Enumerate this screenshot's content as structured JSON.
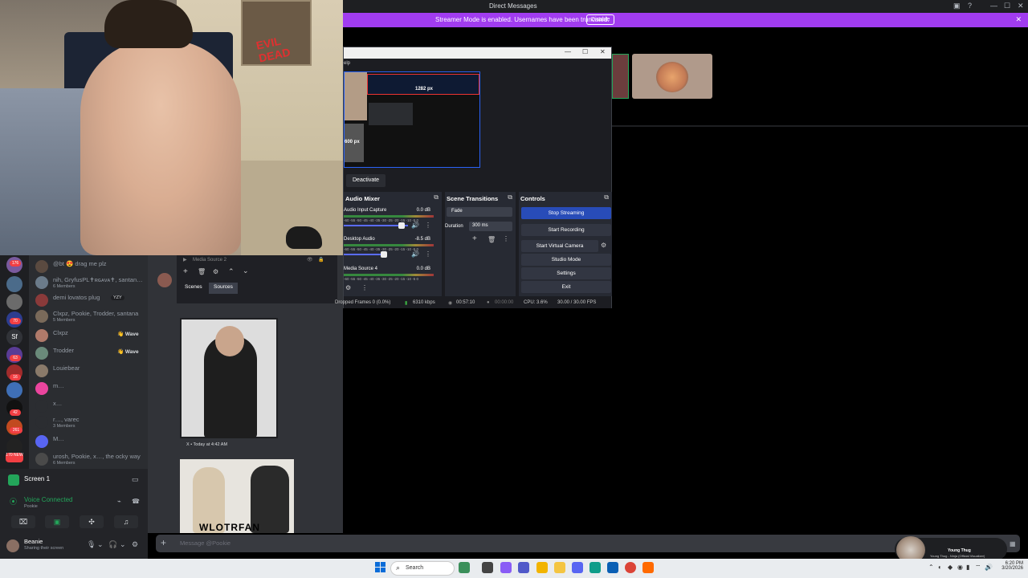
{
  "discord": {
    "window_title": "Direct Messages",
    "banner": {
      "text": "Streamer Mode is enabled. Usernames have been truncated.",
      "disable_label": "Disable"
    },
    "dm_list": [
      {
        "name": "@bt 😍 drag me plz",
        "sub": "",
        "badge": ""
      },
      {
        "name": "nih, GryfusPL✝ʀɢᴀᴠᴀ✝, santan…",
        "sub": "6 Members",
        "badge": ""
      },
      {
        "name": "demi lovatos plug",
        "sub": "",
        "badge": "YZY"
      },
      {
        "name": "Clxpz, Pookie, Trodder, santana",
        "sub": "5 Members",
        "badge": ""
      },
      {
        "name": "Clxpz",
        "sub": "",
        "badge": "Wave"
      },
      {
        "name": "Trodder",
        "sub": "",
        "badge": "Wave"
      },
      {
        "name": "Louiebear",
        "sub": "",
        "badge": ""
      },
      {
        "name": "m…",
        "sub": "",
        "badge": ""
      },
      {
        "name": "x…",
        "sub": "",
        "badge": ""
      },
      {
        "name": "r…, varec",
        "sub": "3 Members",
        "badge": ""
      },
      {
        "name": "M…",
        "sub": "",
        "badge": ""
      },
      {
        "name": "urosh, Pookie, x…, the ocky way",
        "sub": "6 Members",
        "badge": ""
      }
    ],
    "server_badges": [
      "176",
      "",
      "70",
      "",
      "Sf",
      "63",
      "",
      "16",
      "",
      "42",
      "261",
      "170 NEW"
    ],
    "voice": {
      "screen_label": "Screen 1",
      "connected_label": "Voice Connected",
      "connected_sub": "Pookie"
    },
    "user": {
      "name": "Beanie",
      "status": "Sharing their screen"
    },
    "chat": {
      "obs_tabs": [
        "Scenes",
        "Sources"
      ],
      "source_label": "Media Source 2",
      "caption": "X • Today at 4:42 AM",
      "image2_text": "WLOTRFAN",
      "message_placeholder": "Message @Pookie"
    }
  },
  "obs": {
    "menu": "elp",
    "preview_labels": [
      "1282 px",
      "600 px"
    ],
    "deactivate_label": "Deactivate",
    "audio_mixer": {
      "title": "Audio Mixer",
      "scale": "-60 -55 -50 -45 -40 -35 -30 -25 -20 -15 -10 -5 0",
      "channels": [
        {
          "name": "Audio Input Capture",
          "db": "0.0 dB"
        },
        {
          "name": "Desktop Audio",
          "db": "-8.5 dB"
        },
        {
          "name": "Media Source 4",
          "db": "0.0 dB"
        }
      ]
    },
    "scene_transitions": {
      "title": "Scene Transitions",
      "transition": "Fade",
      "duration_label": "Duration",
      "duration_value": "300 ms"
    },
    "controls": {
      "title": "Controls",
      "buttons": [
        "Stop Streaming",
        "Start Recording",
        "Start Virtual Camera",
        "Studio Mode",
        "Settings",
        "Exit"
      ]
    },
    "status": {
      "dropped": "Dropped Frames 0 (0.0%)",
      "kbps": "6310 kbps",
      "stream_time": "00:57:10",
      "rec_time": "00:00:00",
      "cpu": "CPU: 3.6%",
      "fps": "30.00 / 30.00 FPS"
    }
  },
  "taskbar": {
    "search_label": "Search",
    "time": "6:20 PM",
    "date": "3/20/2026"
  },
  "now_playing": {
    "title": "Young Thug",
    "subtitle": "Young Thug - Ninja (Official Visualizer)"
  },
  "colors": {
    "discord_bg": "#313338",
    "streamer_banner": "#a13cf0",
    "obs_primary": "#284cb8",
    "voice_green": "#23a55a"
  }
}
